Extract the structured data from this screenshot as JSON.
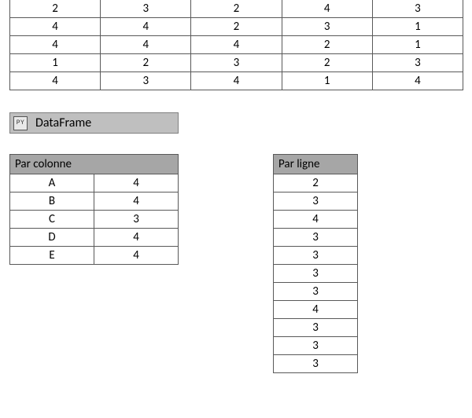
{
  "top_table": {
    "rows": [
      [
        "2",
        "3",
        "2",
        "4",
        "3"
      ],
      [
        "4",
        "4",
        "2",
        "3",
        "1"
      ],
      [
        "4",
        "4",
        "4",
        "2",
        "1"
      ],
      [
        "1",
        "2",
        "3",
        "2",
        "3"
      ],
      [
        "4",
        "3",
        "4",
        "1",
        "4"
      ]
    ]
  },
  "dataframe_cell": {
    "icon_text": "PY",
    "label": "DataFrame"
  },
  "par_colonne": {
    "header": "Par colonne",
    "rows": [
      {
        "k": "A",
        "v": "4"
      },
      {
        "k": "B",
        "v": "4"
      },
      {
        "k": "C",
        "v": "3"
      },
      {
        "k": "D",
        "v": "4"
      },
      {
        "k": "E",
        "v": "4"
      }
    ]
  },
  "par_ligne": {
    "header": "Par ligne",
    "values": [
      "2",
      "3",
      "4",
      "3",
      "3",
      "3",
      "3",
      "4",
      "3",
      "3",
      "3"
    ]
  }
}
